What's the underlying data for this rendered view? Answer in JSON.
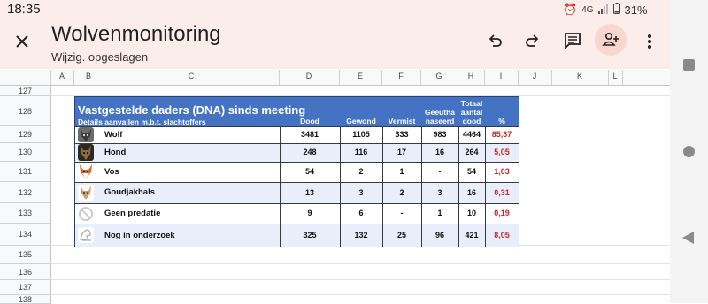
{
  "status": {
    "time": "18:35",
    "network": "4G",
    "battery": "31%"
  },
  "appbar": {
    "title": "Wolvenmonitoring",
    "subtitle": "Wijzig. opgeslagen"
  },
  "columns": [
    "A",
    "B",
    "C",
    "D",
    "E",
    "F",
    "G",
    "H",
    "I",
    "J",
    "K",
    "L"
  ],
  "row_numbers": [
    "127",
    "128",
    "129",
    "130",
    "131",
    "132",
    "133",
    "134",
    "135",
    "136",
    "137",
    "138"
  ],
  "table": {
    "title": "Vastgestelde daders (DNA) sinds meeting",
    "subtitle": "Details aanvallen m.b.t. slachtoffers",
    "headers": {
      "dood": "Dood",
      "gewond": "Gewond",
      "vermist": "Vermist",
      "geeuthanaseerd_1": "Geeutha",
      "geeuthanaseerd_2": "naseerd",
      "totaal_1": "Totaal",
      "totaal_2": "aantal",
      "totaal_3": "dood",
      "pct": "%"
    },
    "rows": [
      {
        "name": "Wolf",
        "dood": "3481",
        "gewond": "1105",
        "vermist": "333",
        "geeuth": "983",
        "totaal": "4464",
        "pct": "85,37",
        "icon": "wolf-icon"
      },
      {
        "name": "Hond",
        "dood": "248",
        "gewond": "116",
        "vermist": "17",
        "geeuth": "16",
        "totaal": "264",
        "pct": "5,05",
        "icon": "dog-icon"
      },
      {
        "name": "Vos",
        "dood": "54",
        "gewond": "2",
        "vermist": "1",
        "geeuth": "-",
        "totaal": "54",
        "pct": "1,03",
        "icon": "fox-icon"
      },
      {
        "name": "Goudjakhals",
        "dood": "13",
        "gewond": "3",
        "vermist": "2",
        "geeuth": "3",
        "totaal": "16",
        "pct": "0,31",
        "icon": "jackal-icon"
      },
      {
        "name": "Geen predatie",
        "dood": "9",
        "gewond": "6",
        "vermist": "-",
        "geeuth": "1",
        "totaal": "10",
        "pct": "0,19",
        "icon": "no-predation-icon"
      },
      {
        "name": "Nog in onderzoek",
        "dood": "325",
        "gewond": "132",
        "vermist": "25",
        "geeuth": "96",
        "totaal": "421",
        "pct": "8,05",
        "icon": "under-investigation-icon"
      }
    ]
  },
  "colors": {
    "header_blue": "#4573c4",
    "pct_red": "#c62828",
    "appbar_bg": "#fbeeea"
  }
}
